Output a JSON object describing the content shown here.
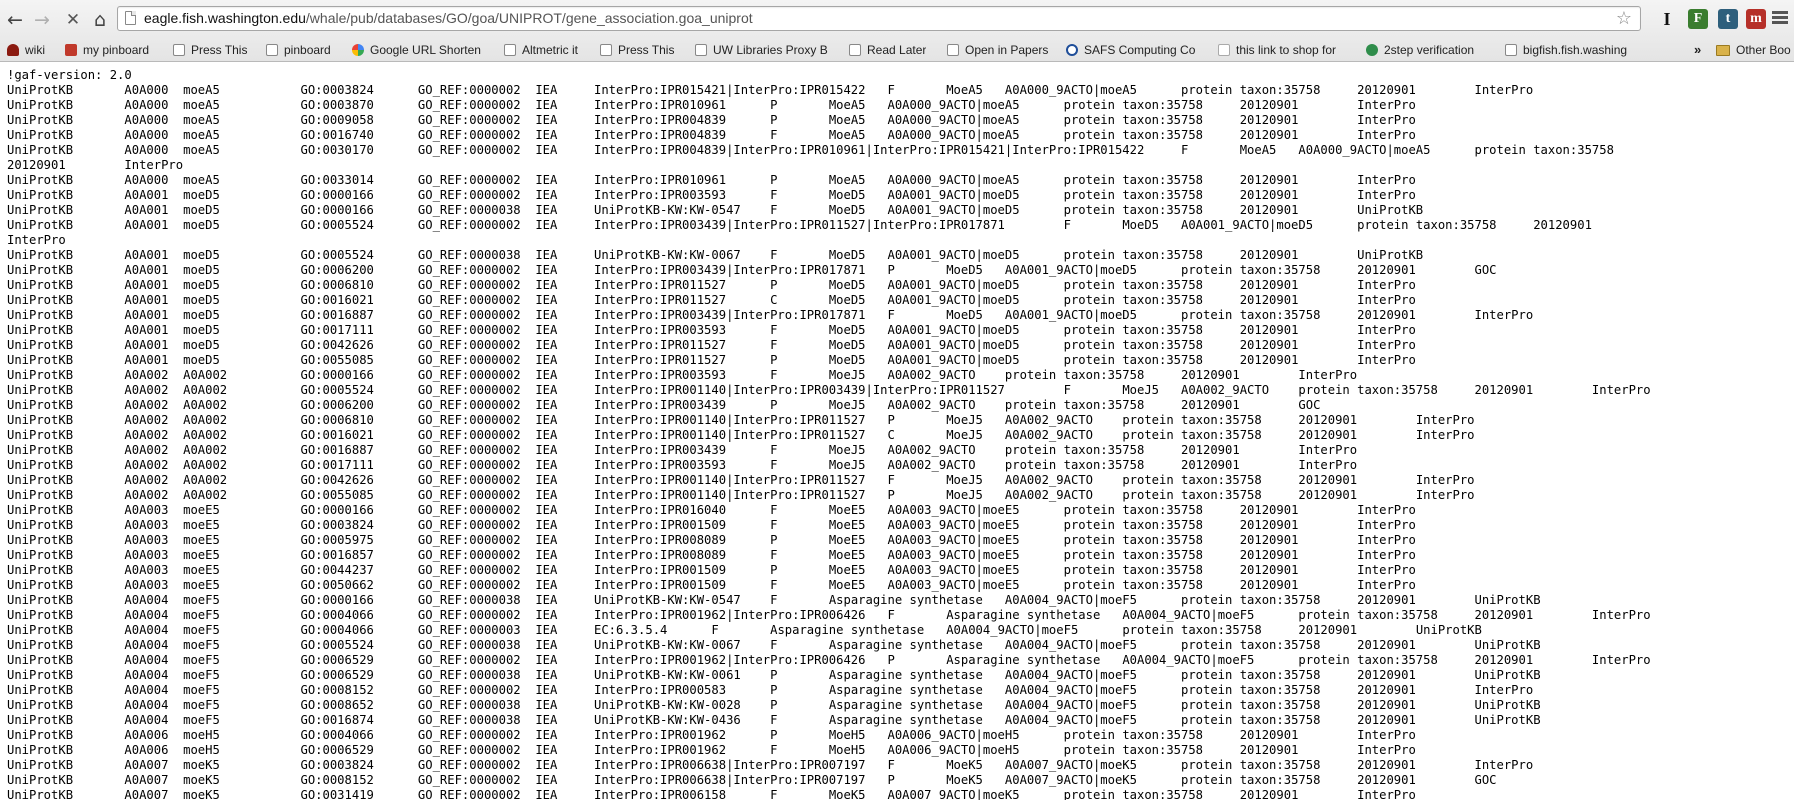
{
  "browser": {
    "url_host": "eagle.fish.washington.edu",
    "url_path": "/whale/pub/databases/GO/goa/UNIPROT/gene_association.goa_uniprot",
    "icons": {
      "back": "arrow-left-icon",
      "forward": "arrow-right-icon",
      "stop": "close-icon",
      "home": "home-icon",
      "star": "star-icon",
      "menu": "wrench-menu-icon"
    },
    "extensions": [
      "I",
      "F",
      "t",
      "m"
    ]
  },
  "bookmarks": [
    {
      "label": "wiki",
      "icon": "wiki-icon"
    },
    {
      "label": "my pinboard",
      "icon": "pinboard-icon"
    },
    {
      "label": "Press This",
      "icon": "page-icon"
    },
    {
      "label": "pinboard",
      "icon": "page-icon"
    },
    {
      "label": "Google URL Shorten",
      "icon": "google-icon"
    },
    {
      "label": "Altmetric it",
      "icon": "page-icon"
    },
    {
      "label": "Press This",
      "icon": "page-icon"
    },
    {
      "label": "UW Libraries Proxy B",
      "icon": "page-icon"
    },
    {
      "label": "Read Later",
      "icon": "page-icon"
    },
    {
      "label": "Open in Papers",
      "icon": "page-icon"
    },
    {
      "label": "SAFS Computing Co",
      "icon": "safs-icon"
    },
    {
      "label": "this link to shop for",
      "icon": "amazon-icon"
    },
    {
      "label": "2step verification",
      "icon": "twostep-icon"
    },
    {
      "label": "bigfish.fish.washing",
      "icon": "page-icon"
    }
  ],
  "bookmarks_more": "»",
  "bookmarks_other": "Other Boo",
  "document": {
    "text": "!gaf-version: 2.0\nUniProtKB\tA0A000\tmoeA5\t\tGO:0003824\tGO_REF:0000002\tIEA\tInterPro:IPR015421|InterPro:IPR015422\tF\tMoeA5\tA0A000_9ACTO|moeA5\tprotein\ttaxon:35758\t20120901\tInterPro\nUniProtKB\tA0A000\tmoeA5\t\tGO:0003870\tGO_REF:0000002\tIEA\tInterPro:IPR010961\tP\tMoeA5\tA0A000_9ACTO|moeA5\tprotein\ttaxon:35758\t20120901\tInterPro\nUniProtKB\tA0A000\tmoeA5\t\tGO:0009058\tGO_REF:0000002\tIEA\tInterPro:IPR004839\tP\tMoeA5\tA0A000_9ACTO|moeA5\tprotein\ttaxon:35758\t20120901\tInterPro\nUniProtKB\tA0A000\tmoeA5\t\tGO:0016740\tGO_REF:0000002\tIEA\tInterPro:IPR004839\tF\tMoeA5\tA0A000_9ACTO|moeA5\tprotein\ttaxon:35758\t20120901\tInterPro\nUniProtKB\tA0A000\tmoeA5\t\tGO:0030170\tGO_REF:0000002\tIEA\tInterPro:IPR004839|InterPro:IPR010961|InterPro:IPR015421|InterPro:IPR015422\tF\tMoeA5\tA0A000_9ACTO|moeA5\tprotein\ttaxon:35758\n20120901\tInterPro\nUniProtKB\tA0A000\tmoeA5\t\tGO:0033014\tGO_REF:0000002\tIEA\tInterPro:IPR010961\tP\tMoeA5\tA0A000_9ACTO|moeA5\tprotein\ttaxon:35758\t20120901\tInterPro\nUniProtKB\tA0A001\tmoeD5\t\tGO:0000166\tGO_REF:0000002\tIEA\tInterPro:IPR003593\tF\tMoeD5\tA0A001_9ACTO|moeD5\tprotein\ttaxon:35758\t20120901\tInterPro\nUniProtKB\tA0A001\tmoeD5\t\tGO:0000166\tGO_REF:0000038\tIEA\tUniProtKB-KW:KW-0547\tF\tMoeD5\tA0A001_9ACTO|moeD5\tprotein\ttaxon:35758\t20120901\tUniProtKB\nUniProtKB\tA0A001\tmoeD5\t\tGO:0005524\tGO_REF:0000002\tIEA\tInterPro:IPR003439|InterPro:IPR011527|InterPro:IPR017871\tF\tMoeD5\tA0A001_9ACTO|moeD5\tprotein\ttaxon:35758\t20120901\nInterPro\nUniProtKB\tA0A001\tmoeD5\t\tGO:0005524\tGO_REF:0000038\tIEA\tUniProtKB-KW:KW-0067\tF\tMoeD5\tA0A001_9ACTO|moeD5\tprotein\ttaxon:35758\t20120901\tUniProtKB\nUniProtKB\tA0A001\tmoeD5\t\tGO:0006200\tGO_REF:0000002\tIEA\tInterPro:IPR003439|InterPro:IPR017871\tP\tMoeD5\tA0A001_9ACTO|moeD5\tprotein\ttaxon:35758\t20120901\tGOC\nUniProtKB\tA0A001\tmoeD5\t\tGO:0006810\tGO_REF:0000002\tIEA\tInterPro:IPR011527\tP\tMoeD5\tA0A001_9ACTO|moeD5\tprotein\ttaxon:35758\t20120901\tInterPro\nUniProtKB\tA0A001\tmoeD5\t\tGO:0016021\tGO_REF:0000002\tIEA\tInterPro:IPR011527\tC\tMoeD5\tA0A001_9ACTO|moeD5\tprotein\ttaxon:35758\t20120901\tInterPro\nUniProtKB\tA0A001\tmoeD5\t\tGO:0016887\tGO_REF:0000002\tIEA\tInterPro:IPR003439|InterPro:IPR017871\tF\tMoeD5\tA0A001_9ACTO|moeD5\tprotein\ttaxon:35758\t20120901\tInterPro\nUniProtKB\tA0A001\tmoeD5\t\tGO:0017111\tGO_REF:0000002\tIEA\tInterPro:IPR003593\tF\tMoeD5\tA0A001_9ACTO|moeD5\tprotein\ttaxon:35758\t20120901\tInterPro\nUniProtKB\tA0A001\tmoeD5\t\tGO:0042626\tGO_REF:0000002\tIEA\tInterPro:IPR011527\tF\tMoeD5\tA0A001_9ACTO|moeD5\tprotein\ttaxon:35758\t20120901\tInterPro\nUniProtKB\tA0A001\tmoeD5\t\tGO:0055085\tGO_REF:0000002\tIEA\tInterPro:IPR011527\tP\tMoeD5\tA0A001_9ACTO|moeD5\tprotein\ttaxon:35758\t20120901\tInterPro\nUniProtKB\tA0A002\tA0A002\t\tGO:0000166\tGO_REF:0000002\tIEA\tInterPro:IPR003593\tF\tMoeJ5\tA0A002_9ACTO\tprotein\ttaxon:35758\t20120901\tInterPro\nUniProtKB\tA0A002\tA0A002\t\tGO:0005524\tGO_REF:0000002\tIEA\tInterPro:IPR001140|InterPro:IPR003439|InterPro:IPR011527\tF\tMoeJ5\tA0A002_9ACTO\tprotein\ttaxon:35758\t20120901\tInterPro\nUniProtKB\tA0A002\tA0A002\t\tGO:0006200\tGO_REF:0000002\tIEA\tInterPro:IPR003439\tP\tMoeJ5\tA0A002_9ACTO\tprotein\ttaxon:35758\t20120901\tGOC\nUniProtKB\tA0A002\tA0A002\t\tGO:0006810\tGO_REF:0000002\tIEA\tInterPro:IPR001140|InterPro:IPR011527\tP\tMoeJ5\tA0A002_9ACTO\tprotein\ttaxon:35758\t20120901\tInterPro\nUniProtKB\tA0A002\tA0A002\t\tGO:0016021\tGO_REF:0000002\tIEA\tInterPro:IPR001140|InterPro:IPR011527\tC\tMoeJ5\tA0A002_9ACTO\tprotein\ttaxon:35758\t20120901\tInterPro\nUniProtKB\tA0A002\tA0A002\t\tGO:0016887\tGO_REF:0000002\tIEA\tInterPro:IPR003439\tF\tMoeJ5\tA0A002_9ACTO\tprotein\ttaxon:35758\t20120901\tInterPro\nUniProtKB\tA0A002\tA0A002\t\tGO:0017111\tGO_REF:0000002\tIEA\tInterPro:IPR003593\tF\tMoeJ5\tA0A002_9ACTO\tprotein\ttaxon:35758\t20120901\tInterPro\nUniProtKB\tA0A002\tA0A002\t\tGO:0042626\tGO_REF:0000002\tIEA\tInterPro:IPR001140|InterPro:IPR011527\tF\tMoeJ5\tA0A002_9ACTO\tprotein\ttaxon:35758\t20120901\tInterPro\nUniProtKB\tA0A002\tA0A002\t\tGO:0055085\tGO_REF:0000002\tIEA\tInterPro:IPR001140|InterPro:IPR011527\tP\tMoeJ5\tA0A002_9ACTO\tprotein\ttaxon:35758\t20120901\tInterPro\nUniProtKB\tA0A003\tmoeE5\t\tGO:0000166\tGO_REF:0000002\tIEA\tInterPro:IPR016040\tF\tMoeE5\tA0A003_9ACTO|moeE5\tprotein\ttaxon:35758\t20120901\tInterPro\nUniProtKB\tA0A003\tmoeE5\t\tGO:0003824\tGO_REF:0000002\tIEA\tInterPro:IPR001509\tF\tMoeE5\tA0A003_9ACTO|moeE5\tprotein\ttaxon:35758\t20120901\tInterPro\nUniProtKB\tA0A003\tmoeE5\t\tGO:0005975\tGO_REF:0000002\tIEA\tInterPro:IPR008089\tP\tMoeE5\tA0A003_9ACTO|moeE5\tprotein\ttaxon:35758\t20120901\tInterPro\nUniProtKB\tA0A003\tmoeE5\t\tGO:0016857\tGO_REF:0000002\tIEA\tInterPro:IPR008089\tF\tMoeE5\tA0A003_9ACTO|moeE5\tprotein\ttaxon:35758\t20120901\tInterPro\nUniProtKB\tA0A003\tmoeE5\t\tGO:0044237\tGO_REF:0000002\tIEA\tInterPro:IPR001509\tP\tMoeE5\tA0A003_9ACTO|moeE5\tprotein\ttaxon:35758\t20120901\tInterPro\nUniProtKB\tA0A003\tmoeE5\t\tGO:0050662\tGO_REF:0000002\tIEA\tInterPro:IPR001509\tF\tMoeE5\tA0A003_9ACTO|moeE5\tprotein\ttaxon:35758\t20120901\tInterPro\nUniProtKB\tA0A004\tmoeF5\t\tGO:0000166\tGO_REF:0000038\tIEA\tUniProtKB-KW:KW-0547\tF\tAsparagine synthetase\tA0A004_9ACTO|moeF5\tprotein\ttaxon:35758\t20120901\tUniProtKB\nUniProtKB\tA0A004\tmoeF5\t\tGO:0004066\tGO_REF:0000002\tIEA\tInterPro:IPR001962|InterPro:IPR006426\tF\tAsparagine synthetase\tA0A004_9ACTO|moeF5\tprotein\ttaxon:35758\t20120901\tInterPro\nUniProtKB\tA0A004\tmoeF5\t\tGO:0004066\tGO_REF:0000003\tIEA\tEC:6.3.5.4\tF\tAsparagine synthetase\tA0A004_9ACTO|moeF5\tprotein\ttaxon:35758\t20120901\tUniProtKB\nUniProtKB\tA0A004\tmoeF5\t\tGO:0005524\tGO_REF:0000038\tIEA\tUniProtKB-KW:KW-0067\tF\tAsparagine synthetase\tA0A004_9ACTO|moeF5\tprotein\ttaxon:35758\t20120901\tUniProtKB\nUniProtKB\tA0A004\tmoeF5\t\tGO:0006529\tGO_REF:0000002\tIEA\tInterPro:IPR001962|InterPro:IPR006426\tP\tAsparagine synthetase\tA0A004_9ACTO|moeF5\tprotein\ttaxon:35758\t20120901\tInterPro\nUniProtKB\tA0A004\tmoeF5\t\tGO:0006529\tGO_REF:0000038\tIEA\tUniProtKB-KW:KW-0061\tP\tAsparagine synthetase\tA0A004_9ACTO|moeF5\tprotein\ttaxon:35758\t20120901\tUniProtKB\nUniProtKB\tA0A004\tmoeF5\t\tGO:0008152\tGO_REF:0000002\tIEA\tInterPro:IPR000583\tP\tAsparagine synthetase\tA0A004_9ACTO|moeF5\tprotein\ttaxon:35758\t20120901\tInterPro\nUniProtKB\tA0A004\tmoeF5\t\tGO:0008652\tGO_REF:0000038\tIEA\tUniProtKB-KW:KW-0028\tP\tAsparagine synthetase\tA0A004_9ACTO|moeF5\tprotein\ttaxon:35758\t20120901\tUniProtKB\nUniProtKB\tA0A004\tmoeF5\t\tGO:0016874\tGO_REF:0000038\tIEA\tUniProtKB-KW:KW-0436\tF\tAsparagine synthetase\tA0A004_9ACTO|moeF5\tprotein\ttaxon:35758\t20120901\tUniProtKB\nUniProtKB\tA0A006\tmoeH5\t\tGO:0004066\tGO_REF:0000002\tIEA\tInterPro:IPR001962\tP\tMoeH5\tA0A006_9ACTO|moeH5\tprotein\ttaxon:35758\t20120901\tInterPro\nUniProtKB\tA0A006\tmoeH5\t\tGO:0006529\tGO_REF:0000002\tIEA\tInterPro:IPR001962\tF\tMoeH5\tA0A006_9ACTO|moeH5\tprotein\ttaxon:35758\t20120901\tInterPro\nUniProtKB\tA0A007\tmoeK5\t\tGO:0003824\tGO_REF:0000002\tIEA\tInterPro:IPR006638|InterPro:IPR007197\tF\tMoeK5\tA0A007_9ACTO|moeK5\tprotein\ttaxon:35758\t20120901\tInterPro\nUniProtKB\tA0A007\tmoeK5\t\tGO:0008152\tGO_REF:0000002\tIEA\tInterPro:IPR006638|InterPro:IPR007197\tP\tMoeK5\tA0A007_9ACTO|moeK5\tprotein\ttaxon:35758\t20120901\tGOC\nUniProtKB\tA0A007\tmoeK5\t\tGO:0031419\tGO_REF:0000002\tIEA\tInterPro:IPR006158\tF\tMoeK5\tA0A007_9ACTO|moeK5\tprotein\ttaxon:35758\t20120901\tInterPro"
  }
}
